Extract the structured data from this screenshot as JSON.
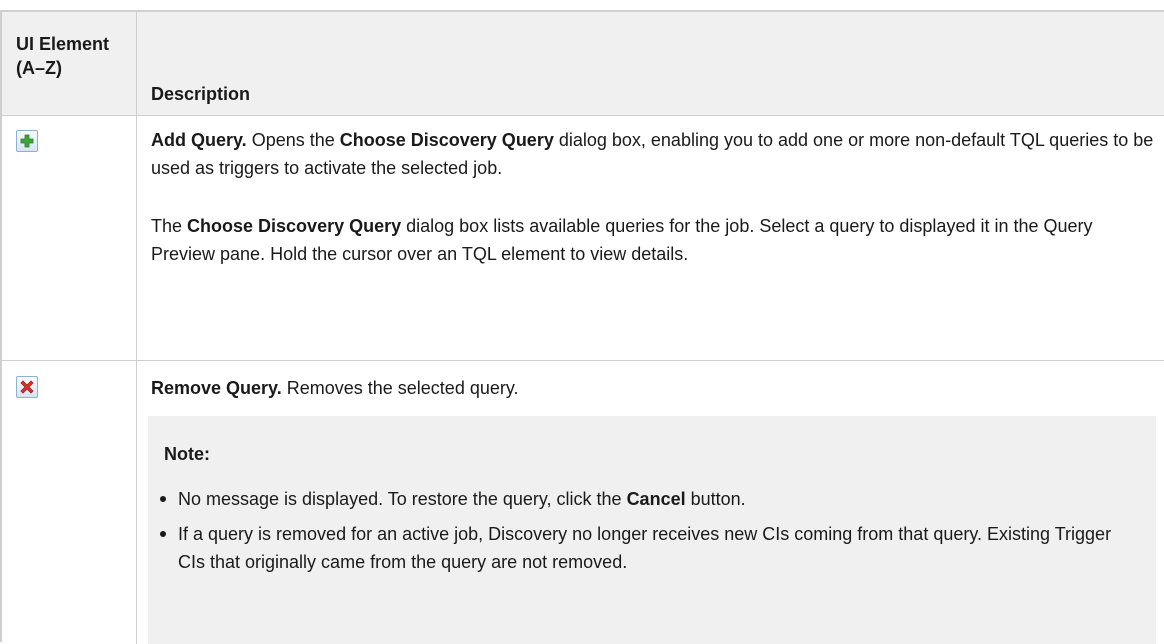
{
  "header": {
    "col1": "UI Element (A–Z)",
    "col2": "Description"
  },
  "rows": [
    {
      "icon": "add-icon",
      "title": "Add Query.",
      "text1": " Opens the ",
      "bold1": "Choose Discovery Query",
      "text2": " dialog box, enabling you to add one or more non-default TQL queries to be used as triggers to activate the selected job.",
      "para2_bold": "Choose Discovery Query",
      "para2_pre": "The ",
      "para2_post": " dialog box lists available queries for the job. Select a query to displayed it in the Query Preview pane. Hold the cursor over an TQL element to view details."
    },
    {
      "icon": "remove-icon",
      "title": "Remove Query.",
      "text": " Removes the selected query.",
      "note_title": "Note:",
      "notes": [
        {
          "pre": "No message is displayed. To restore the query, click the ",
          "bold": "Cancel",
          "post": " button."
        },
        {
          "text": "If a query is removed for an active job, Discovery no longer receives new CIs coming from that query. Existing Trigger CIs that originally came from the query are not removed."
        }
      ]
    }
  ],
  "colors": {
    "border": "#cfcfcf",
    "header_bg": "#f0f0f0",
    "note_bg": "#f0f0f0",
    "add_icon": "#3fa53a",
    "remove_icon": "#d9322c"
  }
}
